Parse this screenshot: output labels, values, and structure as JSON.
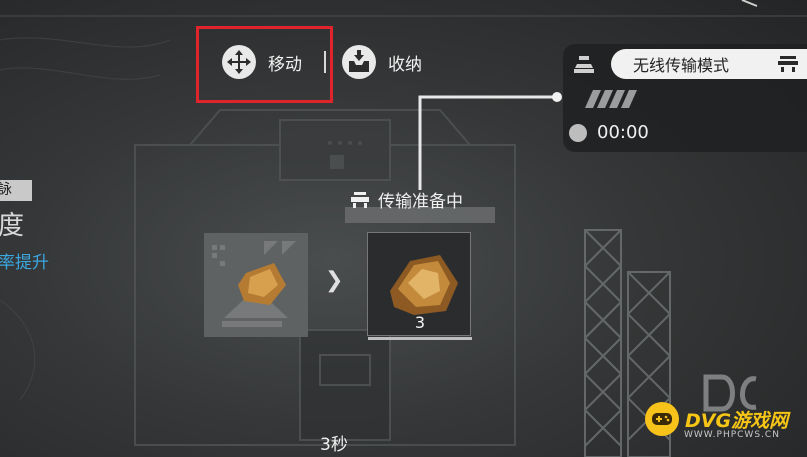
{
  "toolbar": {
    "move_label": "移动",
    "store_label": "收纳"
  },
  "mode_panel": {
    "mode_label": "无线传输模式",
    "timer": "00:00"
  },
  "transfer": {
    "status_label": "传输准备中",
    "output_count": "3"
  },
  "left_panel": {
    "tag_text": "詠",
    "big_text": "度",
    "blue_text": "率提升"
  },
  "footer": {
    "countdown": "3秒"
  },
  "watermark": {
    "brand": "DVG游戏网",
    "url": "WWW.PHPCWS.CN"
  },
  "colors": {
    "highlight": "#e0242b",
    "accent_blue": "#3ba7e0",
    "brand_yellow": "#f6c516"
  }
}
